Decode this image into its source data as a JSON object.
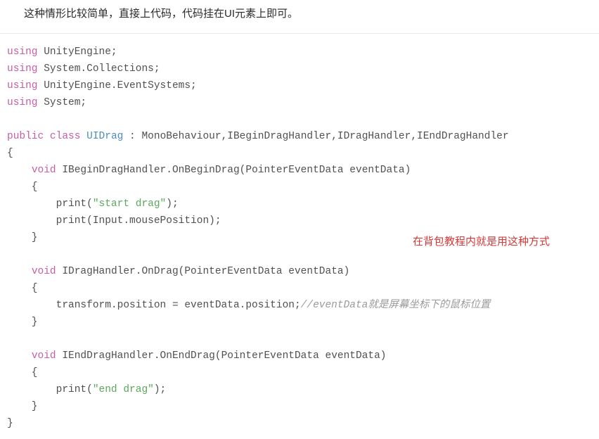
{
  "intro": "这种情形比较简单，直接上代码，代码挂在UI元素上即可。",
  "kw": {
    "using": "using",
    "public": "public",
    "class": "class",
    "void": "void"
  },
  "code": {
    "ns1": " UnityEngine;",
    "ns2": " System.Collections;",
    "ns3": " UnityEngine.EventSystems;",
    "ns4": " System;",
    "clsName": "UIDrag",
    "clsRest": " : MonoBehaviour,IBeginDragHandler,IDragHandler,IEndDragHandler",
    "openBrace": "{",
    "m1sig": " IBeginDragHandler.OnBeginDrag(PointerEventData eventData)",
    "m1open": "    {",
    "m1l1a": "        print(",
    "m1l1str": "\"start drag\"",
    "m1l1b": ");",
    "m1l2": "        print(Input.mousePosition);",
    "m1close": "    }",
    "m2sig": " IDragHandler.OnDrag(PointerEventData eventData)",
    "m2open": "    {",
    "m2l1": "        transform.position = eventData.position;",
    "m2cmt": "//eventData就是屏幕坐标下的鼠标位置",
    "m2close": "    }",
    "m3sig": " IEndDragHandler.OnEndDrag(PointerEventData eventData)",
    "m3open": "    {",
    "m3l1a": "        print(",
    "m3l1str": "\"end drag\"",
    "m3l1b": ");",
    "m3close": "    }",
    "closeBrace": "}"
  },
  "annotation": "在背包教程内就是用这种方式"
}
